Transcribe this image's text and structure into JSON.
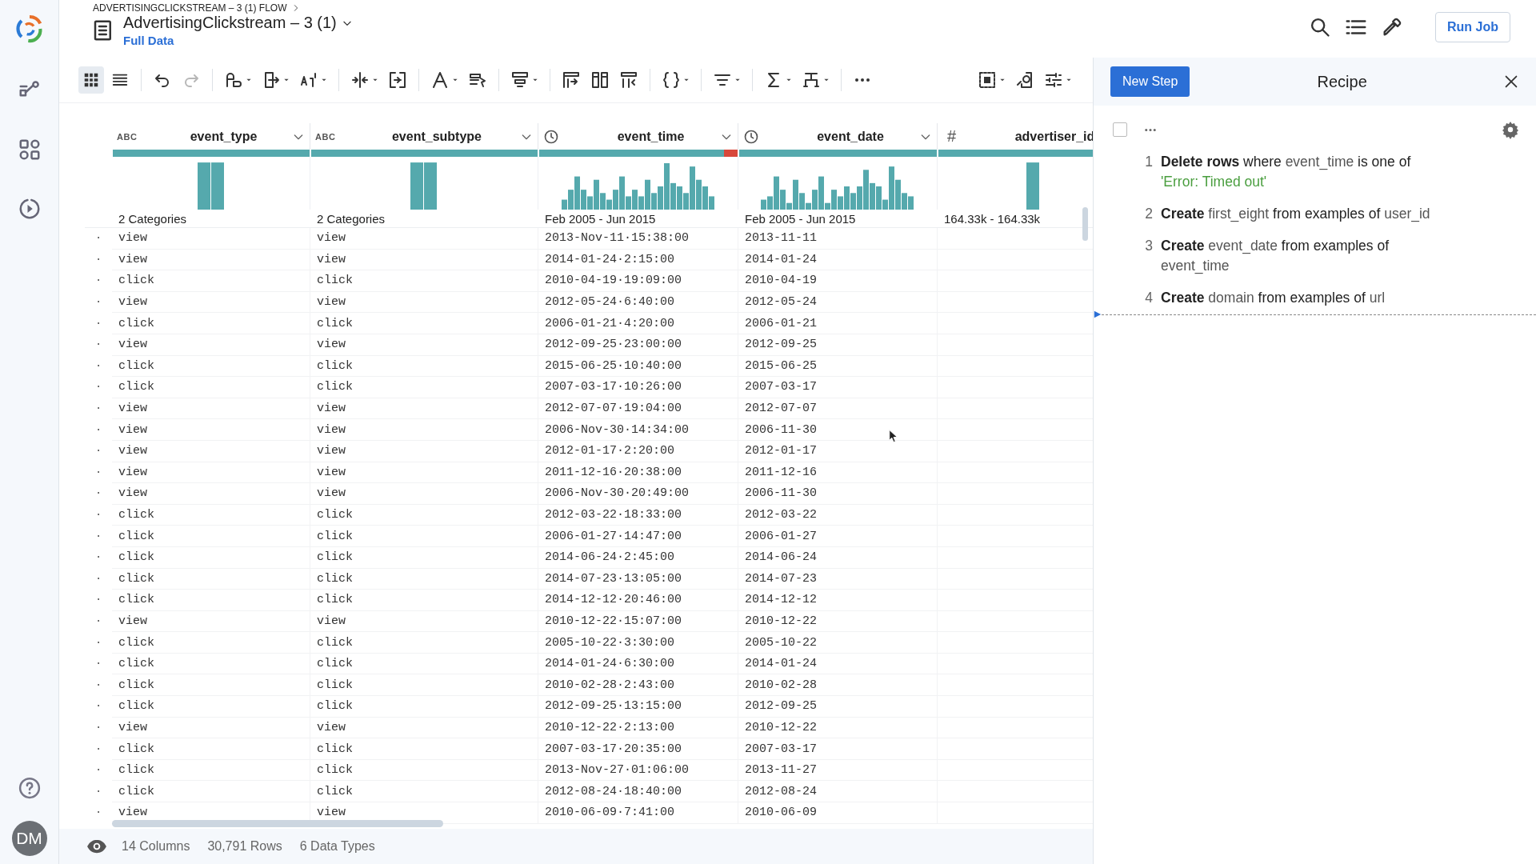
{
  "sidebar": {
    "nav": [
      {
        "kind": "flow",
        "selected": false
      },
      {
        "kind": "library",
        "selected": false
      },
      {
        "kind": "jobs",
        "selected": false
      }
    ],
    "avatar": "DM"
  },
  "header": {
    "breadcrumb": "ADVERTISINGCLICKSTREAM – 3 (1) FLOW",
    "title": "AdvertisingClickstream – 3 (1)",
    "sample": "Full Data",
    "run_button": "Run Job"
  },
  "view_toggle": [
    {
      "kind": "grid",
      "selected": true
    },
    {
      "kind": "list",
      "selected": false
    }
  ],
  "toolbar": [
    {
      "kind": "undo",
      "has_menu": false,
      "disabled": false
    },
    {
      "kind": "redo",
      "has_menu": false,
      "disabled": true
    },
    {
      "kind": "separator"
    },
    {
      "kind": "rename",
      "has_menu": true,
      "disabled": false
    },
    {
      "kind": "move",
      "has_menu": true,
      "disabled": false
    },
    {
      "kind": "sort",
      "has_menu": true,
      "disabled": false
    },
    {
      "kind": "separator"
    },
    {
      "kind": "split",
      "has_menu": true,
      "disabled": false
    },
    {
      "kind": "merge",
      "has_menu": false,
      "disabled": false
    },
    {
      "kind": "separator"
    },
    {
      "kind": "format",
      "has_menu": true,
      "disabled": false
    },
    {
      "kind": "clean",
      "has_menu": false,
      "disabled": false
    },
    {
      "kind": "separator"
    },
    {
      "kind": "header",
      "has_menu": true,
      "disabled": false
    },
    {
      "kind": "separator"
    },
    {
      "kind": "pivot",
      "has_menu": false,
      "disabled": false
    },
    {
      "kind": "join",
      "has_menu": false,
      "disabled": false
    },
    {
      "kind": "union",
      "has_menu": false,
      "disabled": false
    },
    {
      "kind": "separator"
    },
    {
      "kind": "braces",
      "has_menu": true,
      "disabled": false
    },
    {
      "kind": "separator"
    },
    {
      "kind": "filter",
      "has_menu": true,
      "disabled": false
    },
    {
      "kind": "separator"
    },
    {
      "kind": "sum",
      "has_menu": true,
      "disabled": false
    },
    {
      "kind": "tree",
      "has_menu": true,
      "disabled": false
    },
    {
      "kind": "separator"
    },
    {
      "kind": "more",
      "has_menu": false,
      "disabled": false
    },
    {
      "kind": "spacer"
    },
    {
      "kind": "select",
      "has_menu": true,
      "disabled": false
    },
    {
      "kind": "find",
      "has_menu": false,
      "disabled": false
    },
    {
      "kind": "adjust",
      "has_menu": true,
      "disabled": false
    }
  ],
  "table": {
    "columns": [
      {
        "name": "event_type",
        "menu": true,
        "kind": "string",
        "type_label": "ABC",
        "quality": {
          "level": 1
        },
        "summary": "2 Categories"
      },
      {
        "name": "event_subtype",
        "menu": true,
        "kind": "string",
        "type_label": "ABC",
        "quality": {
          "level": 1
        },
        "summary": "2 Categories"
      },
      {
        "name": "event_time",
        "menu": true,
        "kind": "datetime",
        "quality": {
          "level": 0.93
        },
        "summary": "Feb 2005 - Jun 2015"
      },
      {
        "name": "event_date",
        "menu": true,
        "kind": "datetime",
        "quality": {
          "level": 1
        },
        "summary": "Feb 2005 - Jun 2015"
      },
      {
        "name": "advertiser_id",
        "menu": false,
        "kind": "integer",
        "type_label": "#",
        "quality": {
          "level": 1
        },
        "summary": "164.33k - 164.33k"
      }
    ],
    "rows": [
      {
        "gutter": "·",
        "cells": [
          "view",
          "view",
          "2013-Nov-11·15:38:00",
          "2013-11-11"
        ]
      },
      {
        "gutter": "·",
        "cells": [
          "view",
          "view",
          "2014-01-24·2:15:00",
          "2014-01-24"
        ]
      },
      {
        "gutter": "·",
        "cells": [
          "click",
          "click",
          "2010-04-19·19:09:00",
          "2010-04-19"
        ]
      },
      {
        "gutter": "·",
        "cells": [
          "view",
          "view",
          "2012-05-24·6:40:00",
          "2012-05-24"
        ]
      },
      {
        "gutter": "·",
        "cells": [
          "click",
          "click",
          "2006-01-21·4:20:00",
          "2006-01-21"
        ]
      },
      {
        "gutter": "·",
        "cells": [
          "view",
          "view",
          "2012-09-25·23:00:00",
          "2012-09-25"
        ]
      },
      {
        "gutter": "·",
        "cells": [
          "click",
          "click",
          "2015-06-25·10:40:00",
          "2015-06-25"
        ]
      },
      {
        "gutter": "·",
        "cells": [
          "click",
          "click",
          "2007-03-17·10:26:00",
          "2007-03-17"
        ]
      },
      {
        "gutter": "·",
        "cells": [
          "view",
          "view",
          "2012-07-07·19:04:00",
          "2012-07-07"
        ]
      },
      {
        "gutter": "·",
        "cells": [
          "view",
          "view",
          "2006-Nov-30·14:34:00",
          "2006-11-30"
        ]
      },
      {
        "gutter": "·",
        "cells": [
          "view",
          "view",
          "2012-01-17·2:20:00",
          "2012-01-17"
        ]
      },
      {
        "gutter": "·",
        "cells": [
          "view",
          "view",
          "2011-12-16·20:38:00",
          "2011-12-16"
        ]
      },
      {
        "gutter": "·",
        "cells": [
          "view",
          "view",
          "2006-Nov-30·20:49:00",
          "2006-11-30"
        ]
      },
      {
        "gutter": "·",
        "cells": [
          "click",
          "click",
          "2012-03-22·18:33:00",
          "2012-03-22"
        ]
      },
      {
        "gutter": "·",
        "cells": [
          "click",
          "click",
          "2006-01-27·14:47:00",
          "2006-01-27"
        ]
      },
      {
        "gutter": "·",
        "cells": [
          "click",
          "click",
          "2014-06-24·2:45:00",
          "2014-06-24"
        ]
      },
      {
        "gutter": "·",
        "cells": [
          "click",
          "click",
          "2014-07-23·13:05:00",
          "2014-07-23"
        ]
      },
      {
        "gutter": "·",
        "cells": [
          "click",
          "click",
          "2014-12-12·20:46:00",
          "2014-12-12"
        ]
      },
      {
        "gutter": "·",
        "cells": [
          "view",
          "view",
          "2010-12-22·15:07:00",
          "2010-12-22"
        ]
      },
      {
        "gutter": "·",
        "cells": [
          "click",
          "click",
          "2005-10-22·3:30:00",
          "2005-10-22"
        ]
      },
      {
        "gutter": "·",
        "cells": [
          "click",
          "click",
          "2014-01-24·6:30:00",
          "2014-01-24"
        ]
      },
      {
        "gutter": "·",
        "cells": [
          "click",
          "click",
          "2010-02-28·2:43:00",
          "2010-02-28"
        ]
      },
      {
        "gutter": "·",
        "cells": [
          "click",
          "click",
          "2012-09-25·13:15:00",
          "2012-09-25"
        ]
      },
      {
        "gutter": "·",
        "cells": [
          "view",
          "view",
          "2010-12-22·2:13:00",
          "2010-12-22"
        ]
      },
      {
        "gutter": "·",
        "cells": [
          "click",
          "click",
          "2007-03-17·20:35:00",
          "2007-03-17"
        ]
      },
      {
        "gutter": "·",
        "cells": [
          "click",
          "click",
          "2013-Nov-27·01:06:00",
          "2013-11-27"
        ]
      },
      {
        "gutter": "·",
        "cells": [
          "click",
          "click",
          "2012-08-24·18:40:00",
          "2012-08-24"
        ]
      },
      {
        "gutter": "·",
        "cells": [
          "view",
          "view",
          "2010-06-09·7:41:00",
          "2010-06-09"
        ]
      }
    ]
  },
  "status_bar": {
    "items": [
      "14 Columns",
      "30,791 Rows",
      "6 Data Types"
    ]
  },
  "recipe": {
    "new_step": "New Step",
    "title": "Recipe",
    "select_all": {
      "checked": false
    },
    "steps": [
      {
        "number": "1",
        "parts": [
          {
            "kind": "verb",
            "text": "Delete rows"
          },
          {
            "kind": "text",
            "text": " where "
          },
          {
            "kind": "column",
            "text": "event_time"
          },
          {
            "kind": "text",
            "text": " is one of "
          },
          {
            "kind": "value",
            "text": "'Error: Timed out'"
          }
        ]
      },
      {
        "number": "2",
        "parts": [
          {
            "kind": "verb",
            "text": "Create"
          },
          {
            "kind": "column",
            "text": " first_eight"
          },
          {
            "kind": "text",
            "text": " from examples of "
          },
          {
            "kind": "column",
            "text": "user_id"
          }
        ]
      },
      {
        "number": "3",
        "parts": [
          {
            "kind": "verb",
            "text": "Create"
          },
          {
            "kind": "column",
            "text": " event_date"
          },
          {
            "kind": "text",
            "text": " from examples of "
          },
          {
            "kind": "column",
            "text": "event_time"
          }
        ]
      },
      {
        "number": "4",
        "parts": [
          {
            "kind": "verb",
            "text": "Create"
          },
          {
            "kind": "column",
            "text": " domain"
          },
          {
            "kind": "text",
            "text": " from examples of "
          },
          {
            "kind": "column",
            "text": "url"
          }
        ]
      }
    ]
  }
}
